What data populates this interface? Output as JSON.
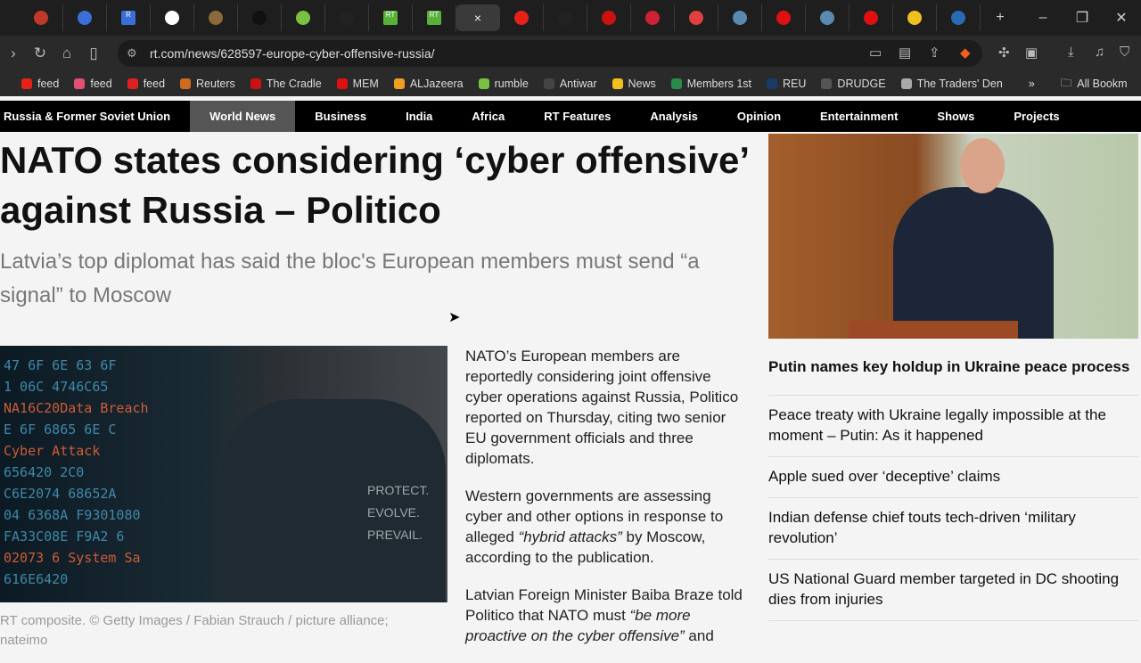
{
  "browser": {
    "tabs": [
      {
        "color": "#c0392b"
      },
      {
        "color": "#3b6fd8"
      },
      {
        "color": "#3b6fd8",
        "glyph": "R"
      },
      {
        "color": "#ffffff"
      },
      {
        "color": "#8a6a3a"
      },
      {
        "color": "#111111"
      },
      {
        "color": "#7ac142"
      },
      {
        "color": "#222222"
      },
      {
        "color": "#58b23a",
        "glyph": "RT"
      },
      {
        "color": "#58b23a",
        "glyph": "RT"
      },
      {
        "active": true,
        "glyph": "×"
      },
      {
        "color": "#e62117"
      },
      {
        "color": "#222222"
      },
      {
        "color": "#cc1111"
      },
      {
        "color": "#cc2233"
      },
      {
        "color": "#e04040"
      },
      {
        "color": "#5a8ab0"
      },
      {
        "color": "#e01010"
      },
      {
        "color": "#5a8ab0"
      },
      {
        "color": "#e01010"
      },
      {
        "color": "#f0c020"
      },
      {
        "color": "#2a6ab0"
      }
    ],
    "new_tab": "+",
    "url": "rt.com/news/628597-europe-cyber-offensive-russia/",
    "bookmarks": [
      {
        "label": "feed",
        "color": "#e62117"
      },
      {
        "label": "feed",
        "color": "#e05070"
      },
      {
        "label": "feed",
        "color": "#dd2222"
      },
      {
        "label": "Reuters",
        "color": "#d06a20"
      },
      {
        "label": "The Cradle",
        "color": "#cc1111"
      },
      {
        "label": "MEM",
        "color": "#e01010"
      },
      {
        "label": "ALJazeera",
        "color": "#f0a020"
      },
      {
        "label": "rumble",
        "color": "#7ac142"
      },
      {
        "label": "Antiwar",
        "color": "#444444"
      },
      {
        "label": "News",
        "color": "#f0c020"
      },
      {
        "label": "Members 1st",
        "color": "#2a8a4a"
      },
      {
        "label": "REU",
        "color": "#1a3a6a"
      },
      {
        "label": "DRUDGE",
        "color": "#555555"
      },
      {
        "label": "The Traders' Den",
        "color": "#aaaaaa"
      }
    ],
    "more": "»",
    "all_bookmarks": "All Bookm"
  },
  "site_nav": [
    "Russia & Former Soviet Union",
    "World News",
    "Business",
    "India",
    "Africa",
    "RT Features",
    "Analysis",
    "Opinion",
    "Entertainment",
    "Shows",
    "Projects"
  ],
  "article": {
    "headline": "NATO states considering ‘cyber offensive’ against Russia – Politico",
    "subhead": "Latvia’s top diplomat has said the bloc's European members must send “a signal” to Moscow",
    "image_text": [
      "47 6F 6E 63 6F",
      "1 06C 4746C65",
      "NA16C20Data Breach",
      "E 6F 6865 6E C",
      "Cyber Attack",
      "656420 2C0",
      "C6E2074 68652A",
      "04 6368A F9301080",
      "FA33C08E F9A2 6",
      "02073 6 System Sa",
      "616E6420"
    ],
    "shirt_text": [
      "PROTECT.",
      "EVOLVE.",
      "PREVAIL."
    ],
    "caption": "RT composite. © Getty Images / Fabian Strauch / picture alliance; nateimo",
    "p1": "NATO’s European members are reportedly considering joint offensive cyber operations against Russia, Politico reported on Thursday, citing two senior EU government officials and three diplomats.",
    "p2a": "Western governments are assessing cyber and other options in response to alleged ",
    "p2q": "“hybrid attacks”",
    "p2b": " by Moscow, according to the publication.",
    "p3a": "Latvian Foreign Minister Baiba Braze told Politico that NATO must ",
    "p3q": "“be more proactive on the cyber offensive”",
    "p3b": " and"
  },
  "sidebar": {
    "top": "Putin names key holdup in Ukraine peace process",
    "items": [
      "Peace treaty with Ukraine legally impossible at the moment – Putin: As it happened",
      "Apple sued over ‘deceptive’ claims",
      "Indian defense chief touts tech-driven ‘military revolution’",
      "US National Guard member targeted in DC shooting dies from injuries"
    ]
  }
}
